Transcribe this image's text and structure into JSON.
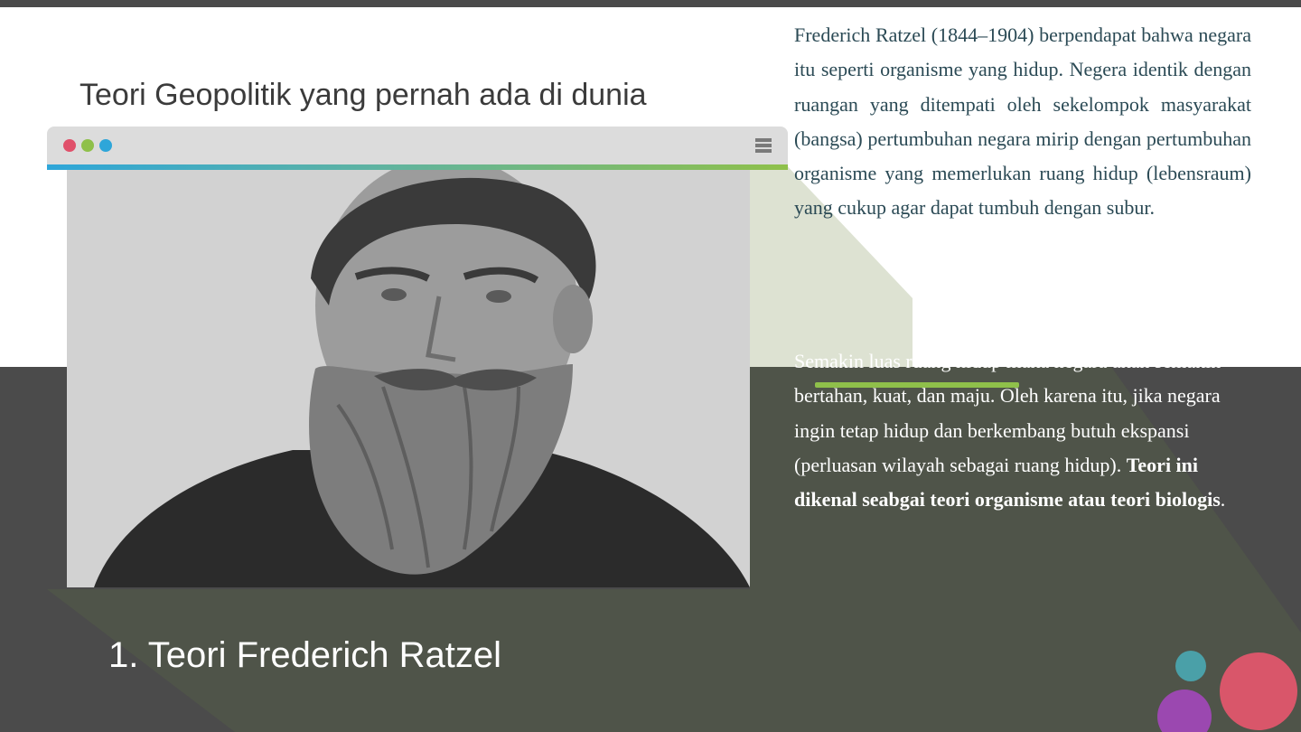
{
  "slide": {
    "heading": "Teori Geopolitik yang pernah ada di dunia",
    "section_title": "1. Teori Frederich Ratzel"
  },
  "browser_frame": {
    "dots": [
      "red",
      "green",
      "blue"
    ],
    "menu_icon": "hamburger-menu-icon",
    "image_description_name": "portrait-photo"
  },
  "content": {
    "paragraph_1": "Frederich Ratzel (1844–1904) berpendapat bahwa negara itu seperti organisme yang hidup. Negera identik dengan ruangan yang ditempati oleh sekelompok masyarakat (bangsa) pertumbuhan negara mirip dengan pertumbuhan organisme yang memerlukan ruang hidup (lebensraum) yang cukup agar dapat tumbuh dengan subur.",
    "paragraph_2_text": "Semakin luas ruang hidup maka negara akan semakin bertahan, kuat, dan maju. Oleh karena itu, jika negara ingin tetap hidup dan berkembang butuh ekspansi (perluasan wilayah sebagai ruang hidup). ",
    "paragraph_2_bold": "Teori ini dikenal seabgai teori organisme atau teori biologis",
    "paragraph_2_end": "."
  },
  "colors": {
    "dark_band": "#4b4b4b",
    "olive_triangle": "#4f5449",
    "accent_green": "#8fc04a",
    "accent_blue": "#2ea6d9",
    "accent_red": "#e0506a",
    "circle_teal": "#4aa0a8",
    "circle_pink": "#d9566a",
    "circle_purple": "#9b48b0"
  }
}
